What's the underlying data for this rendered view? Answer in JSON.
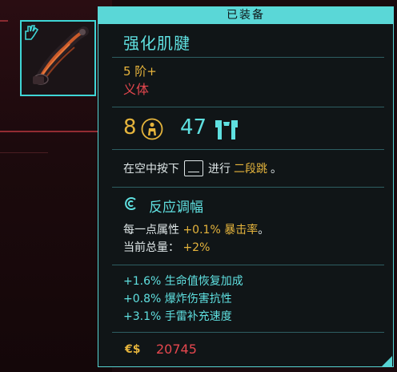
{
  "status_tab": "已装备",
  "item": {
    "name": "强化肌腱",
    "tier": "5 阶+",
    "category": "义体"
  },
  "stats": {
    "requirement": "8",
    "capacity": "47"
  },
  "ability": {
    "pre": "在空中按下",
    "mid": "进行",
    "highlight": "二段跳",
    "end": "。"
  },
  "mod": {
    "title": "反应调幅",
    "line1_pre": "每一点属性",
    "line1_value": "+0.1%",
    "line1_stat": "暴击率",
    "line1_end": "。",
    "line2_pre": "当前总量：",
    "line2_value": "+2%"
  },
  "bonuses": [
    "+1.6% 生命值恢复加成",
    "+0.8% 爆炸伤害抗性",
    "+3.1% 手雷补充速度"
  ],
  "price": {
    "currency_icon": "€$",
    "value": "20745"
  },
  "colors": {
    "accent_cyan": "#5fe0e0",
    "gold": "#e5b43c",
    "red": "#e5474e"
  }
}
